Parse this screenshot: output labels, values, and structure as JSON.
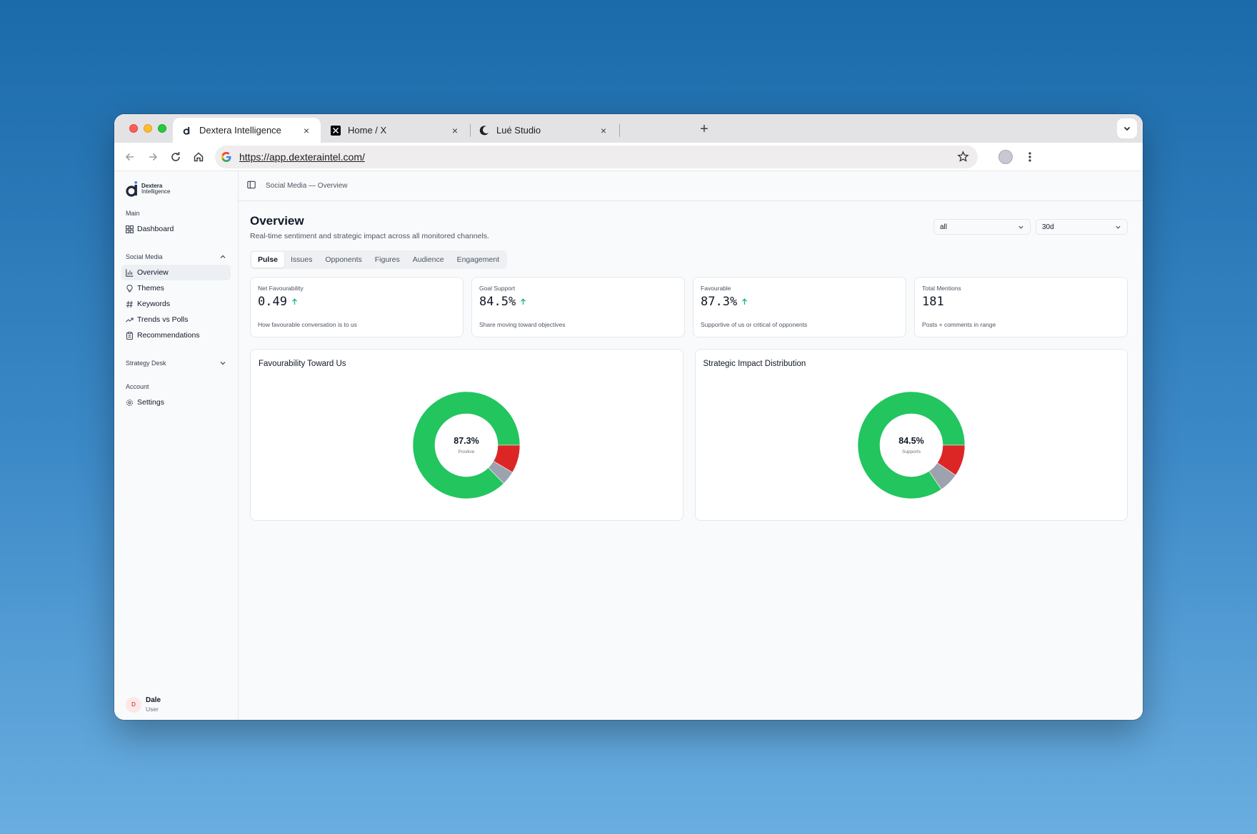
{
  "browser": {
    "tabs": [
      {
        "title": "Dextera Intelligence",
        "icon": "dextera-logo-icon",
        "active": true
      },
      {
        "title": "Home / X",
        "icon": "x-logo-icon",
        "active": false
      },
      {
        "title": "Lué Studio",
        "icon": "moon-icon",
        "active": false
      }
    ],
    "close_glyph": "×",
    "new_tab_glyph": "+",
    "url": "https://app.dexteraintel.com/"
  },
  "sidebar": {
    "logo": {
      "line1": "Dextera",
      "line2": "Intelligence"
    },
    "sections": {
      "main": {
        "label": "Main",
        "items": [
          {
            "label": "Dashboard",
            "icon": "grid-icon"
          }
        ]
      },
      "social": {
        "label": "Social Media",
        "items": [
          {
            "label": "Overview",
            "icon": "bar-chart-icon",
            "active": true
          },
          {
            "label": "Themes",
            "icon": "lightbulb-icon"
          },
          {
            "label": "Keywords",
            "icon": "hash-icon"
          },
          {
            "label": "Trends vs Polls",
            "icon": "trending-up-icon"
          },
          {
            "label": "Recommendations",
            "icon": "clipboard-icon"
          }
        ]
      },
      "strategy": {
        "label": "Strategy Desk"
      },
      "account": {
        "label": "Account",
        "items": [
          {
            "label": "Settings",
            "icon": "gear-icon"
          }
        ]
      }
    },
    "user": {
      "initial": "D",
      "name": "Dale",
      "role": "User"
    }
  },
  "topbar": {
    "breadcrumb": "Social Media — Overview"
  },
  "page": {
    "title": "Overview",
    "subtitle": "Real-time sentiment and strategic impact across all monitored channels.",
    "filters": {
      "channel": "all",
      "range": "30d"
    },
    "tabs": [
      "Pulse",
      "Issues",
      "Opponents",
      "Figures",
      "Audience",
      "Engagement"
    ],
    "active_tab": "Pulse"
  },
  "kpis": [
    {
      "label": "Net Favourability",
      "value": "0.49",
      "trend": "up",
      "desc": "How favourable conversation is to us"
    },
    {
      "label": "Goal Support",
      "value": "84.5%",
      "trend": "up",
      "desc": "Share moving toward objectives"
    },
    {
      "label": "Favourable",
      "value": "87.3%",
      "trend": "up",
      "desc": "Supportive of us or critical of opponents"
    },
    {
      "label": "Total Mentions",
      "value": "181",
      "trend": null,
      "desc": "Posts + comments in range"
    }
  ],
  "colors": {
    "positive": "#22c55e",
    "negative": "#dc2626",
    "neutral": "#9ca3af",
    "trend_up": "#10b981"
  },
  "chart_data": [
    {
      "type": "pie",
      "title": "Favourability Toward Us",
      "center_value": "87.3%",
      "center_label": "Positive",
      "values": [
        87.3,
        8.5,
        4.2
      ]
    },
    {
      "type": "pie",
      "title": "Strategic Impact Distribution",
      "center_value": "84.5%",
      "center_label": "Supports",
      "values": [
        84.5,
        9.5,
        6.0
      ]
    }
  ]
}
